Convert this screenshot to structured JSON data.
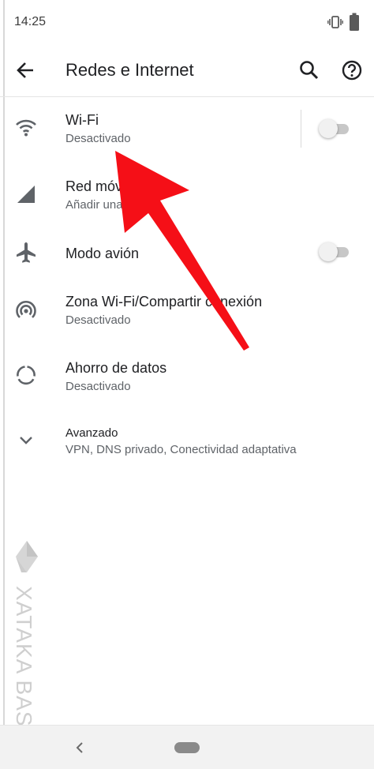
{
  "status_bar": {
    "time": "14:25"
  },
  "app_bar": {
    "title": "Redes e Internet",
    "icons": [
      "back-arrow-icon",
      "search-icon",
      "help-icon"
    ]
  },
  "items": [
    {
      "title": "Wi-Fi",
      "summary": "Desactivado",
      "icon": "wifi-icon",
      "toggle": "off"
    },
    {
      "title": "Red móvil",
      "summary": "Añadir una red",
      "icon": "cell-signal-icon"
    },
    {
      "title": "Modo avión",
      "summary": "",
      "icon": "airplane-icon",
      "toggle": "off"
    },
    {
      "title": "Zona Wi-Fi/Compartir conexión",
      "summary": "Desactivado",
      "icon": "hotspot-icon"
    },
    {
      "title": "Ahorro de datos",
      "summary": "Desactivado",
      "icon": "data-saver-icon"
    },
    {
      "title": "Avanzado",
      "summary": "VPN, DNS privado, Conectividad adaptativa",
      "icon": "chevron-down-icon"
    }
  ],
  "watermark": {
    "text": "XATAKA BASICS"
  },
  "colors": {
    "arrow": "#f50f17",
    "icon": "#5f6368",
    "text_primary": "#202124",
    "text_secondary": "#5f6368"
  }
}
